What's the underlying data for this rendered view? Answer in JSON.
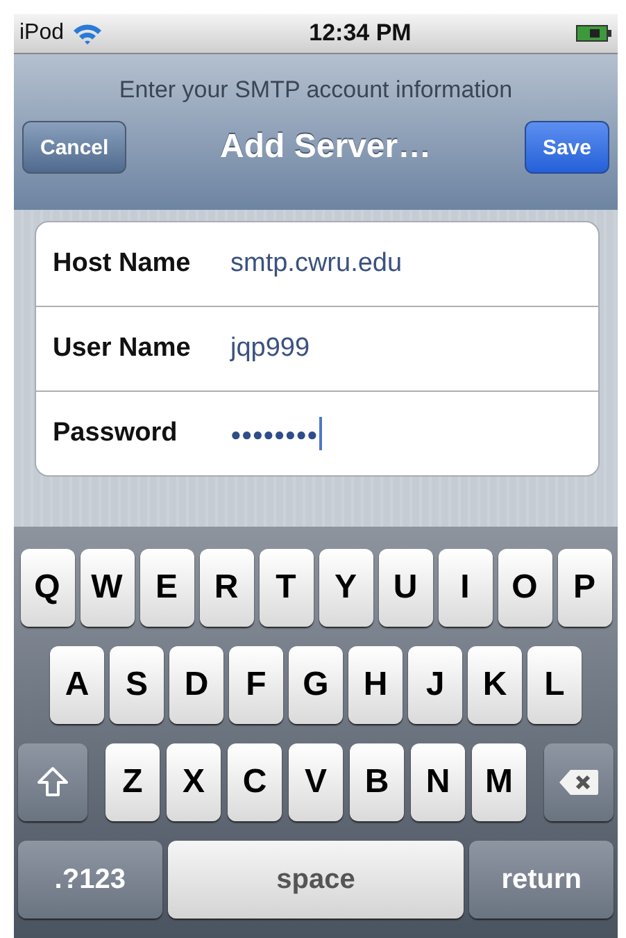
{
  "status_bar": {
    "carrier": "iPod",
    "time": "12:34 PM"
  },
  "nav": {
    "prompt": "Enter your SMTP account information",
    "title": "Add Server…",
    "left_button": "Cancel",
    "right_button": "Save"
  },
  "fields": [
    {
      "label": "Host Name",
      "value": "smtp.cwru.edu",
      "focused": false
    },
    {
      "label": "User Name",
      "value": "jqp999",
      "focused": false
    },
    {
      "label": "Password",
      "value": "●●●●●●●●",
      "focused": true
    }
  ],
  "keyboard": {
    "rows": [
      [
        {
          "kind": "letter",
          "label": "Q"
        },
        {
          "kind": "letter",
          "label": "W"
        },
        {
          "kind": "letter",
          "label": "E"
        },
        {
          "kind": "letter",
          "label": "R"
        },
        {
          "kind": "letter",
          "label": "T"
        },
        {
          "kind": "letter",
          "label": "Y"
        },
        {
          "kind": "letter",
          "label": "U"
        },
        {
          "kind": "letter",
          "label": "I"
        },
        {
          "kind": "letter",
          "label": "O"
        },
        {
          "kind": "letter",
          "label": "P"
        }
      ],
      [
        {
          "kind": "letter",
          "label": "A"
        },
        {
          "kind": "letter",
          "label": "S"
        },
        {
          "kind": "letter",
          "label": "D"
        },
        {
          "kind": "letter",
          "label": "F"
        },
        {
          "kind": "letter",
          "label": "G"
        },
        {
          "kind": "letter",
          "label": "H"
        },
        {
          "kind": "letter",
          "label": "J"
        },
        {
          "kind": "letter",
          "label": "K"
        },
        {
          "kind": "letter",
          "label": "L"
        }
      ],
      [
        {
          "kind": "shift"
        },
        {
          "kind": "letter",
          "label": "Z"
        },
        {
          "kind": "letter",
          "label": "X"
        },
        {
          "kind": "letter",
          "label": "C"
        },
        {
          "kind": "letter",
          "label": "V"
        },
        {
          "kind": "letter",
          "label": "B"
        },
        {
          "kind": "letter",
          "label": "N"
        },
        {
          "kind": "letter",
          "label": "M"
        },
        {
          "kind": "delete"
        }
      ]
    ],
    "bottom_bar": {
      "numbers_key": ".?123",
      "space_key": "space",
      "return_key": "return"
    }
  }
}
